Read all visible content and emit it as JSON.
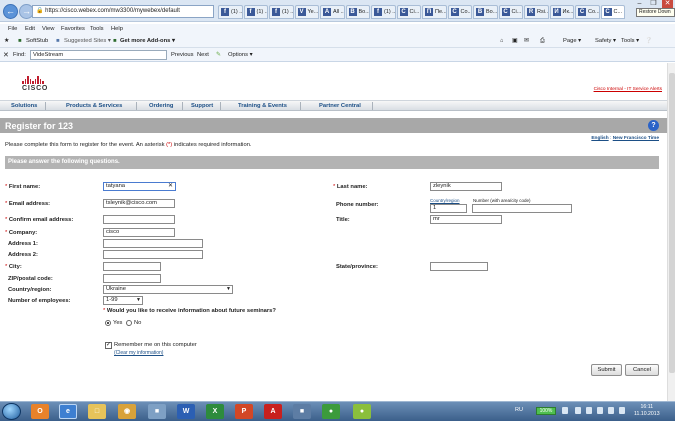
{
  "browser": {
    "address": "https://cisco.webex.com/mw3300/mywebex/default",
    "tabs": [
      {
        "icon": "f",
        "label": "(1) ..."
      },
      {
        "icon": "f",
        "label": "(1) ..."
      },
      {
        "icon": "f",
        "label": "(1) ..."
      },
      {
        "icon": "V",
        "label": "Ye..."
      },
      {
        "icon": "A",
        "label": "All ..."
      },
      {
        "icon": "B",
        "label": "Bo..."
      },
      {
        "icon": "f",
        "label": "(1) ..."
      },
      {
        "icon": "C",
        "label": "Ci..."
      },
      {
        "icon": "П",
        "label": "Пе..."
      },
      {
        "icon": "C",
        "label": "Co..."
      },
      {
        "icon": "B",
        "label": "Bo..."
      },
      {
        "icon": "C",
        "label": "Ci..."
      },
      {
        "icon": "R",
        "label": "Rsi..."
      },
      {
        "icon": "И",
        "label": "Ик..."
      },
      {
        "icon": "C",
        "label": "Co..."
      },
      {
        "icon": "C",
        "label": "C..."
      }
    ],
    "tooltip": "Restore Down",
    "menu": [
      "File",
      "Edit",
      "View",
      "Favorites",
      "Tools",
      "Help"
    ],
    "favorites": {
      "softstub": "SoftStub",
      "suggested": "Suggested Sites ▾",
      "addons": "Get more Add-ons ▾"
    },
    "commands": {
      "page": "Page ▾",
      "safety": "Safety ▾",
      "tools": "Tools ▾"
    },
    "find": {
      "label": "Find:",
      "value": "VideStream",
      "previous": "Previous",
      "next": "Next",
      "options": "Options ▾"
    }
  },
  "site": {
    "logo": "CISCO",
    "internal_link": "Cisco Internal - IT Service Alerts",
    "nav": [
      "Solutions",
      "Products & Services",
      "Ordering",
      "Support",
      "Training & Events",
      "Partner Central"
    ]
  },
  "form": {
    "title": "Register for 123",
    "intro_before": "Please complete this form to register for the event. An asterisk",
    "intro_star": "(*)",
    "intro_after": "indicates required information.",
    "language_english": "English",
    "language_sep": ":",
    "timezone": "New Francisco Time",
    "section_title": "Please answer the following questions.",
    "labels": {
      "first_name": "First name:",
      "email": "Email address:",
      "confirm_email": "Confirm email address:",
      "company": "Company:",
      "address1": "Address 1:",
      "address2": "Address 2:",
      "city": "City:",
      "zip": "ZIP/postal code:",
      "country": "Country/region:",
      "employees": "Number of employees:",
      "last_name": "Last name:",
      "phone": "Phone number:",
      "title": "Title:",
      "state": "State/province:"
    },
    "values": {
      "first_name": "tatyana",
      "email": "tsleynik@cisco.com",
      "company": "cisco",
      "country": "Ukraine",
      "employees": "1-99",
      "last_name": "zleynik",
      "phone_code": "1",
      "title": "mr"
    },
    "phone_hints": {
      "country_region": "Country/region",
      "number": "Number (with area/city code)"
    },
    "seminars_question": "Would you like to receive information about future seminars?",
    "yes": "Yes",
    "no": "No",
    "remember": "Remember me on this computer",
    "clear_info": "(Clear my information)",
    "submit": "Submit",
    "cancel": "Cancel"
  },
  "taskbar": {
    "language": "RU",
    "battery": "100%",
    "time": "16:11",
    "date": "11.10.2013"
  }
}
